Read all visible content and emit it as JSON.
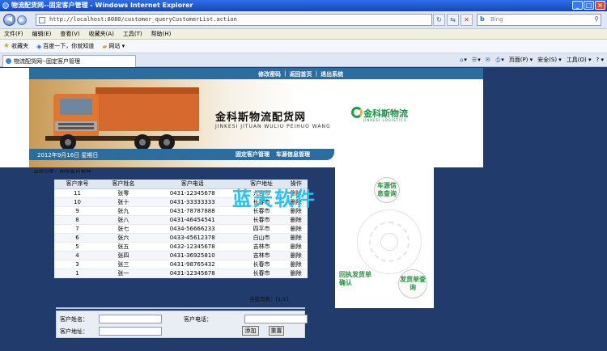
{
  "window": {
    "title": "物流配货网--固定客户管理 - Windows Internet Explorer",
    "minimize": "_",
    "maximize": "□",
    "close": "×"
  },
  "address": {
    "url": "http://localhost:8080/customer_queryCustomerList.action",
    "search_placeholder": "Bing"
  },
  "menu": [
    "文件(F)",
    "编辑(E)",
    "查看(V)",
    "收藏夹(A)",
    "工具(T)",
    "帮助(H)"
  ],
  "favorites": {
    "label": "收藏夹",
    "items": [
      "百度一下，你就知道",
      "网站 ▾"
    ]
  },
  "tab": {
    "label": "物流配货网--固定客户管理"
  },
  "tools": [
    "页面(P) ▾",
    "安全(S) ▾",
    "工具(O) ▾",
    "? ▾"
  ],
  "site": {
    "topnav": [
      "修改密码",
      "返回首页",
      "退出系统"
    ],
    "brand": "金科斯物流配货网",
    "brand_sub": "JINKESI JITUAN WULIU PEIHUO WANG",
    "logo": "金科斯物流",
    "logo_sub": "JINKESI LOGISTICS",
    "date": "2012年9月16日 星期日",
    "subnav": [
      "固定客户管理",
      "车源信息管理"
    ],
    "breadcrumb": "当前位置：固定客户管理"
  },
  "table": {
    "headers": [
      "客户序号",
      "客户姓名",
      "客户电话",
      "客户地址",
      "操作"
    ],
    "rows": [
      [
        "11",
        "张零",
        "0431-12345678",
        "九台市",
        "删除"
      ],
      [
        "10",
        "张十",
        "0431-33333333",
        "长春市",
        "删除"
      ],
      [
        "9",
        "张九",
        "0431-78787888",
        "长春市",
        "删除"
      ],
      [
        "8",
        "张八",
        "0431-46454541",
        "长春市",
        "删除"
      ],
      [
        "7",
        "张七",
        "0434-56666233",
        "四平市",
        "删除"
      ],
      [
        "6",
        "张六",
        "0433-45612378",
        "白山市",
        "删除"
      ],
      [
        "5",
        "张五",
        "0432-12345678",
        "吉林市",
        "删除"
      ],
      [
        "4",
        "张四",
        "0431-36925810",
        "吉林市",
        "删除"
      ],
      [
        "3",
        "张三",
        "0431-98765432",
        "长春市",
        "删除"
      ],
      [
        "1",
        "张一",
        "0431-12345678",
        "长春市",
        "删除"
      ]
    ],
    "pager": "当前页数：[1/1]"
  },
  "form": {
    "name_label": "客户姓名：",
    "phone_label": "客户电话：",
    "address_label": "客户地址：",
    "add_button": "添加",
    "reset_button": "重置"
  },
  "panel": {
    "btn_car": "车源信息查询",
    "btn_receipt": "回执发货单确认",
    "btn_query": "发货单查询"
  },
  "watermark": "蓝天软件"
}
